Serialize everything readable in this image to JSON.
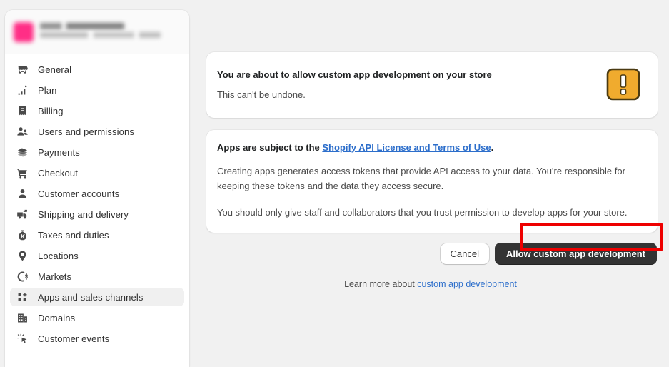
{
  "sidebar": {
    "store": {
      "avatar": "store-avatar-blurred",
      "name_redacted": true
    },
    "items": [
      {
        "label": "General",
        "icon": "storefront-icon",
        "active": false
      },
      {
        "label": "Plan",
        "icon": "bar-chart-icon",
        "active": false
      },
      {
        "label": "Billing",
        "icon": "receipt-dollar-icon",
        "active": false
      },
      {
        "label": "Users and permissions",
        "icon": "users-icon",
        "active": false
      },
      {
        "label": "Payments",
        "icon": "payment-card-icon",
        "active": false
      },
      {
        "label": "Checkout",
        "icon": "shopping-cart-icon",
        "active": false
      },
      {
        "label": "Customer accounts",
        "icon": "person-icon",
        "active": false
      },
      {
        "label": "Shipping and delivery",
        "icon": "delivery-truck-icon",
        "active": false
      },
      {
        "label": "Taxes and duties",
        "icon": "tax-money-bag-icon",
        "active": false
      },
      {
        "label": "Locations",
        "icon": "location-pin-icon",
        "active": false
      },
      {
        "label": "Markets",
        "icon": "globe-currency-icon",
        "active": false
      },
      {
        "label": "Apps and sales channels",
        "icon": "apps-grid-icon",
        "active": true
      },
      {
        "label": "Domains",
        "icon": "domain-building-icon",
        "active": false
      },
      {
        "label": "Customer events",
        "icon": "cursor-click-icon",
        "active": false
      }
    ]
  },
  "main": {
    "warning_card": {
      "title": "You are about to allow custom app development on your store",
      "subtitle": "This can't be undone.",
      "icon": "warning-exclamation-icon"
    },
    "terms_card": {
      "lead_prefix": "Apps are subject to the ",
      "lead_link": "Shopify API License and Terms of Use",
      "lead_suffix": ".",
      "paragraph_1": "Creating apps generates access tokens that provide API access to your data. You're responsible for keeping these tokens and the data they access secure.",
      "paragraph_2": "You should only give staff and collaborators that you trust permission to develop apps for your store."
    },
    "actions": {
      "cancel_label": "Cancel",
      "allow_label": "Allow custom app development"
    },
    "learn_more": {
      "prefix": "Learn more about ",
      "link": "custom app development"
    }
  },
  "colors": {
    "page_background": "#f1f1f1",
    "card_background": "#ffffff",
    "link": "#2c6ecb",
    "primary_button": "#333333",
    "warning_icon": "#eeaa33",
    "highlight_annotation": "#ee0000",
    "active_nav": "#f0f0f0"
  }
}
